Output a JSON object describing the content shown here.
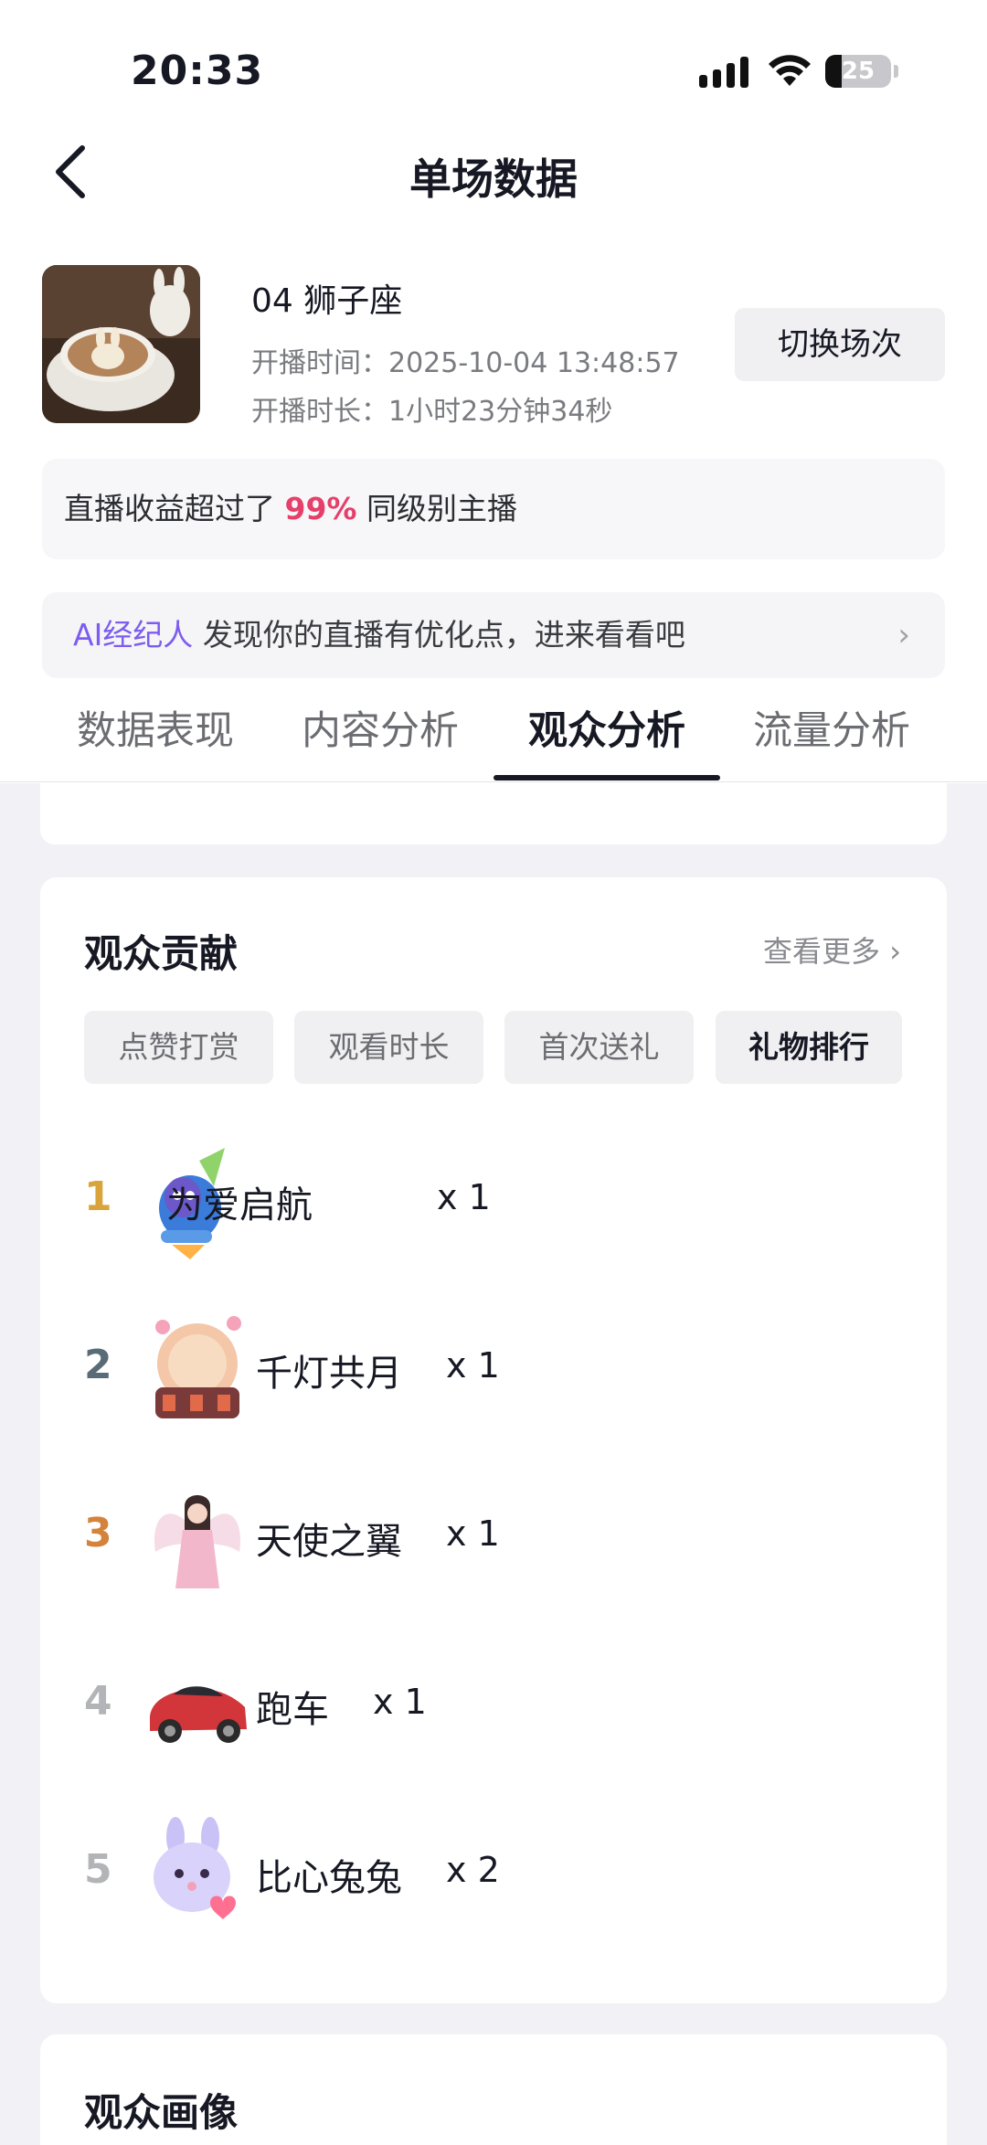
{
  "status": {
    "time": "20:33",
    "battery": "25",
    "battery_level": 0.25
  },
  "nav": {
    "title": "单场数据"
  },
  "session": {
    "name": "04 狮子座",
    "start_label": "开播时间：2025-10-04 13:48:57",
    "duration_label": "开播时长：1小时23分钟34秒",
    "switch_button": "切换场次"
  },
  "earnings": {
    "prefix": "直播收益超过了",
    "percent": "99%",
    "suffix": "同级别主播"
  },
  "ai_agent": {
    "name": "AI经纪人",
    "text": "发现你的直播有优化点，进来看看吧"
  },
  "tabs": [
    {
      "label": "数据表现"
    },
    {
      "label": "内容分析"
    },
    {
      "label": "观众分析"
    },
    {
      "label": "流量分析"
    }
  ],
  "contribution": {
    "title": "观众贡献",
    "more": "查看更多",
    "filters": [
      {
        "label": "点赞打赏"
      },
      {
        "label": "观看时长"
      },
      {
        "label": "首次送礼"
      },
      {
        "label": "礼物排行"
      }
    ],
    "ranking": [
      {
        "rank": "1",
        "name": "为爱启航",
        "count": "x 1",
        "color": "#d9a53a"
      },
      {
        "rank": "2",
        "name": "千灯共月",
        "count": "x 1",
        "color": "#5a6b78"
      },
      {
        "rank": "3",
        "name": "天使之翼",
        "count": "x 1",
        "color": "#d5823a"
      },
      {
        "rank": "4",
        "name": "跑车",
        "count": "x 1",
        "color": "#b3b4b8"
      },
      {
        "rank": "5",
        "name": "比心兔兔",
        "count": "x 2",
        "color": "#b3b4b8"
      }
    ]
  },
  "portrait": {
    "title": "观众画像"
  }
}
